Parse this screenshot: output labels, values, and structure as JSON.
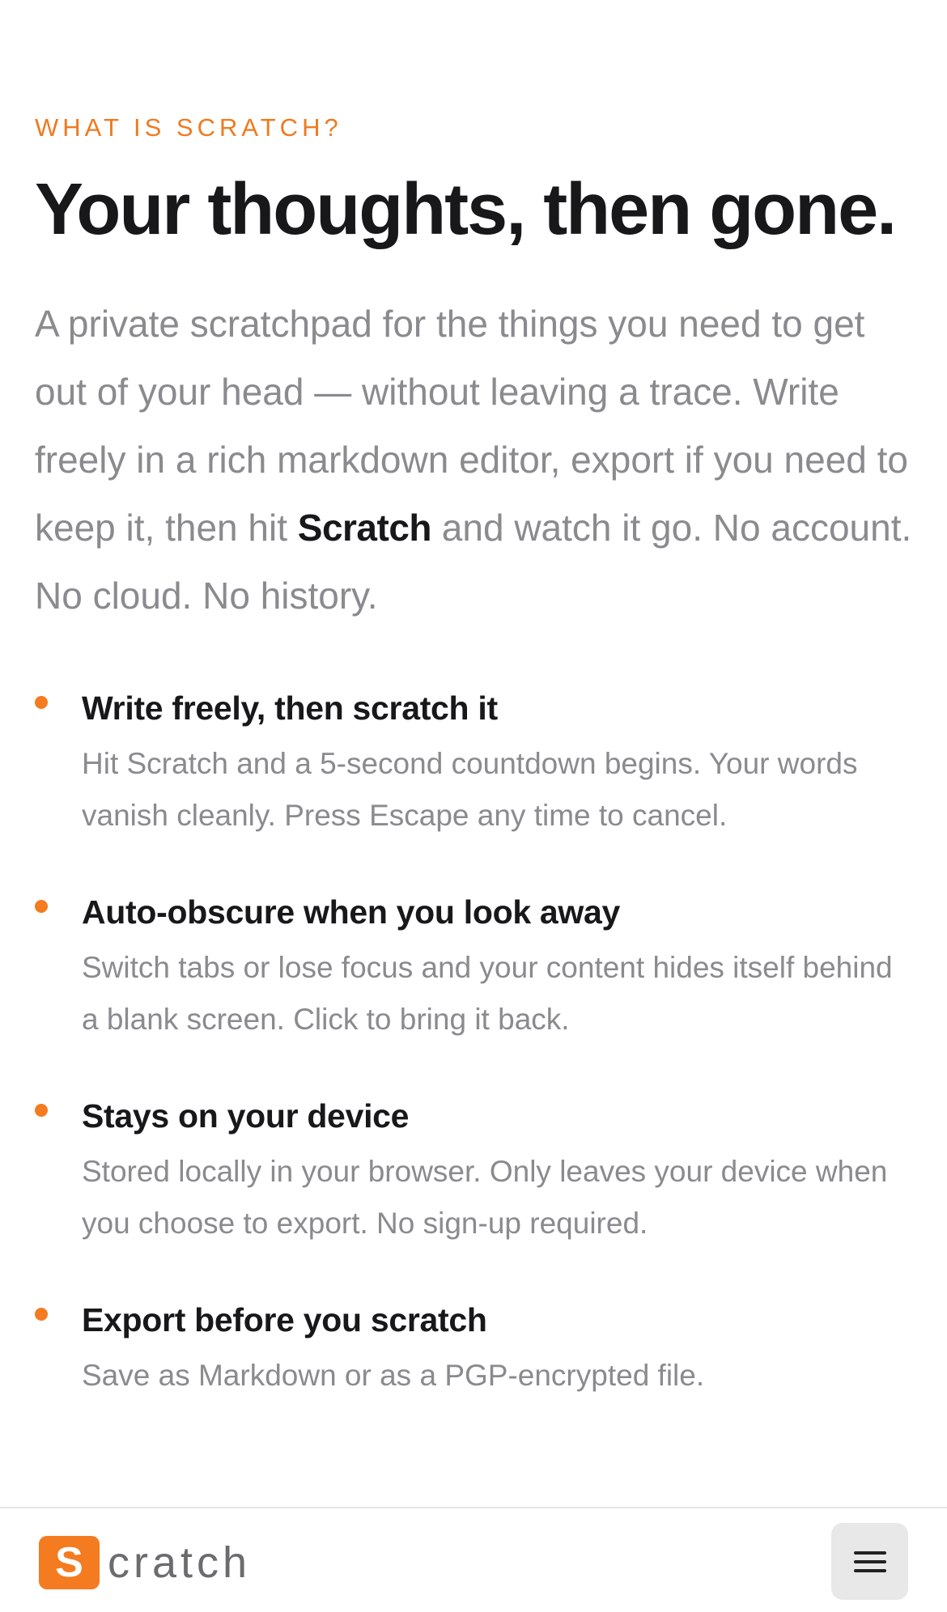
{
  "hero": {
    "eyebrow": "WHAT IS SCRATCH?",
    "headline": "Your thoughts, then gone.",
    "intro_before": "A private scratchpad for the things you need to get out of your head — without leaving a trace. Write freely in a rich markdown editor, export if you need to keep it, then hit ",
    "intro_emphasis": "Scratch",
    "intro_after": " and watch it go. No account. No cloud. No history."
  },
  "features": [
    {
      "title": "Write freely, then scratch it",
      "description": "Hit Scratch and a 5-second countdown begins. Your words vanish cleanly. Press Escape any time to cancel."
    },
    {
      "title": "Auto-obscure when you look away",
      "description": "Switch tabs or lose focus and your content hides itself behind a blank screen. Click to bring it back."
    },
    {
      "title": "Stays on your device",
      "description": "Stored locally in your browser. Only leaves your device when you choose to export. No sign-up required."
    },
    {
      "title": "Export before you scratch",
      "description": "Save as Markdown or as a PGP-encrypted file."
    }
  ],
  "bottom_bar": {
    "logo_letter": "S",
    "logo_rest": "cratch",
    "menu_icon": "hamburger-menu-icon"
  },
  "colors": {
    "accent": "#f47b20",
    "heading": "#18181b",
    "body_text": "#8a8a8f",
    "menu_button_bg": "#e8e8e8"
  }
}
